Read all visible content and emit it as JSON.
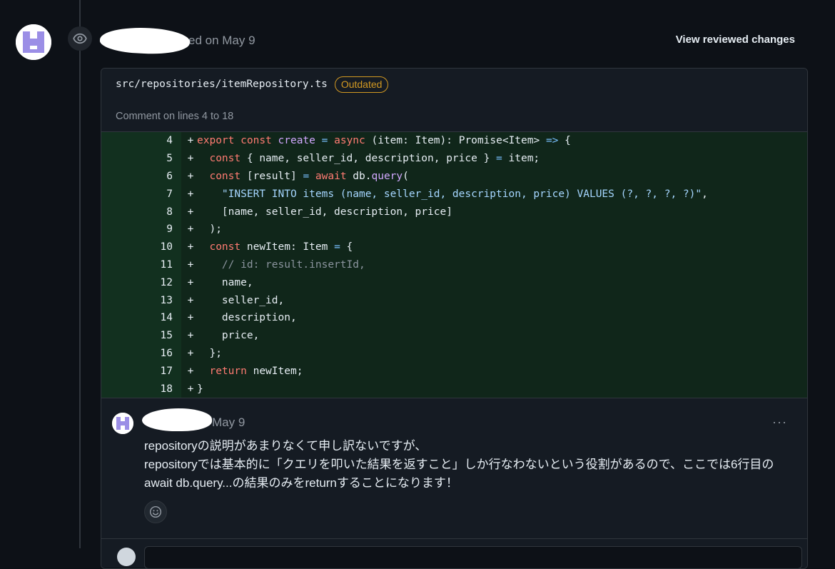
{
  "review": {
    "action_text": "ed on May 9",
    "view_changes_label": "View reviewed changes"
  },
  "file": {
    "path": "src/repositories/itemRepository.ts",
    "badge": "Outdated",
    "comment_range": "Comment on lines 4 to 18"
  },
  "diff_lines": [
    {
      "n": "4",
      "sign": "+"
    },
    {
      "n": "5",
      "sign": "+"
    },
    {
      "n": "6",
      "sign": "+"
    },
    {
      "n": "7",
      "sign": "+"
    },
    {
      "n": "8",
      "sign": "+"
    },
    {
      "n": "9",
      "sign": "+"
    },
    {
      "n": "10",
      "sign": "+"
    },
    {
      "n": "11",
      "sign": "+"
    },
    {
      "n": "12",
      "sign": "+"
    },
    {
      "n": "13",
      "sign": "+"
    },
    {
      "n": "14",
      "sign": "+"
    },
    {
      "n": "15",
      "sign": "+"
    },
    {
      "n": "16",
      "sign": "+"
    },
    {
      "n": "17",
      "sign": "+"
    },
    {
      "n": "18",
      "sign": "+"
    }
  ],
  "code_tokens": {
    "l4": [
      "export",
      " ",
      "const",
      " ",
      "create",
      " ",
      "=",
      " ",
      "async",
      " (item: Item): Promise<Item> ",
      "=>",
      " {"
    ],
    "l5": [
      "  ",
      "const",
      " { name, seller_id, description, price } ",
      "=",
      " item;"
    ],
    "l6": [
      "  ",
      "const",
      " [result] ",
      "=",
      " ",
      "await",
      " db.",
      "query",
      "("
    ],
    "l7": [
      "    ",
      "\"INSERT INTO items (name, seller_id, description, price) VALUES (?, ?, ?, ?)\"",
      ","
    ],
    "l8": [
      "    [name, seller_id, description, price]"
    ],
    "l9": [
      "  );"
    ],
    "l10": [
      "  ",
      "const",
      " newItem: Item ",
      "=",
      " {"
    ],
    "l11": [
      "    ",
      "// id: result.insertId,"
    ],
    "l12": [
      "    name,"
    ],
    "l13": [
      "    seller_id,"
    ],
    "l14": [
      "    description,"
    ],
    "l15": [
      "    price,"
    ],
    "l16": [
      "  };"
    ],
    "l17": [
      "  ",
      "return",
      " newItem;"
    ],
    "l18": [
      "}"
    ]
  },
  "comment": {
    "date": "May 9",
    "more_label": "···",
    "body": [
      "repositoryの説明があまりなくて申し訳ないですが、",
      "repositoryでは基本的に「クエリを叩いた結果を返すこと」しか行なわないという役割があるので、ここでは6行目の",
      "await db.query...の結果のみをreturnすることになります！"
    ]
  },
  "colors": {
    "background": "#0d1117",
    "diff_added": "#10261a",
    "badge_outdated": "#d29922",
    "keyword": "#ff7b72",
    "function": "#d2a8ff",
    "string": "#a5d6ff"
  }
}
